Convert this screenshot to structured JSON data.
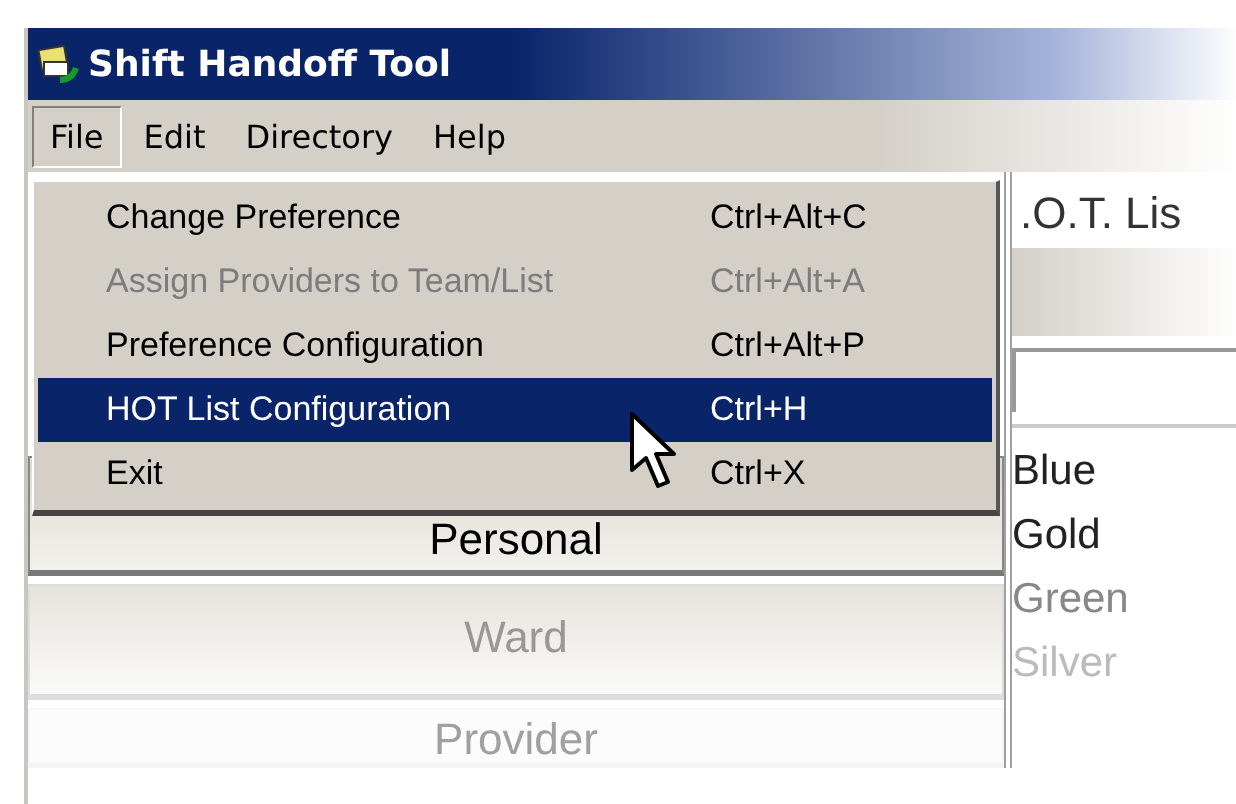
{
  "window": {
    "title": "Shift Handoff Tool"
  },
  "menu_bar": [
    {
      "label": "File",
      "selected": true
    },
    {
      "label": "Edit",
      "selected": false
    },
    {
      "label": "Directory",
      "selected": false
    },
    {
      "label": "Help",
      "selected": false
    }
  ],
  "file_menu": [
    {
      "label": "Change Preference",
      "shortcut": "Ctrl+Alt+C",
      "disabled": false,
      "selected": false
    },
    {
      "label": "Assign Providers to Team/List",
      "shortcut": "Ctrl+Alt+A",
      "disabled": true,
      "selected": false
    },
    {
      "label": "Preference Configuration",
      "shortcut": "Ctrl+Alt+P",
      "disabled": false,
      "selected": false
    },
    {
      "label": "HOT List Configuration",
      "shortcut": "Ctrl+H",
      "disabled": false,
      "selected": true
    },
    {
      "label": "Exit",
      "shortcut": "Ctrl+X",
      "disabled": false,
      "selected": false
    }
  ],
  "buttons": [
    "Personal",
    "Ward",
    "Provider"
  ],
  "list_panel": {
    "header": ".O.T. Lis",
    "items": [
      "Blue",
      "Gold",
      "Green",
      "Silver"
    ]
  }
}
